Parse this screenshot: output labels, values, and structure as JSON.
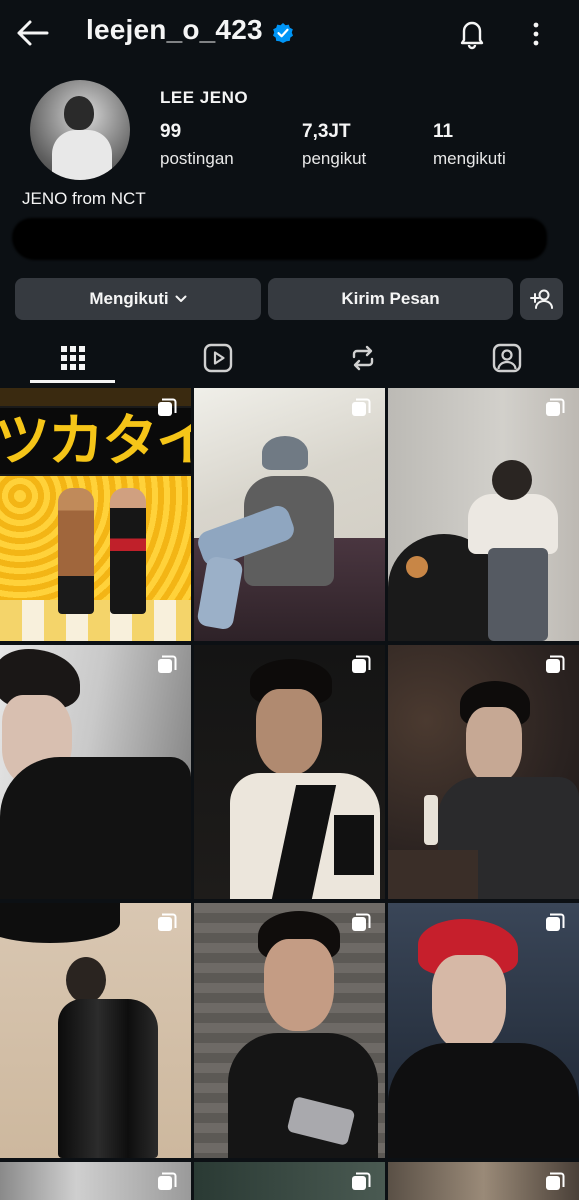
{
  "header": {
    "username": "leejen_o_423",
    "icons": [
      "back-arrow-icon",
      "verified-badge-icon",
      "bell-icon",
      "more-vertical-icon"
    ]
  },
  "profile": {
    "full_name": "LEE JENO",
    "bio": "JENO from NCT",
    "stats": [
      {
        "value": "99",
        "label": "postingan"
      },
      {
        "value": "7,3JT",
        "label": "pengikut"
      },
      {
        "value": "11",
        "label": "mengikuti"
      }
    ]
  },
  "actions": {
    "follow_label": "Mengikuti",
    "message_label": "Kirim Pesan"
  },
  "tabs": [
    {
      "name": "grid",
      "icon": "grid-icon",
      "active": true
    },
    {
      "name": "reels",
      "icon": "reels-icon",
      "active": false
    },
    {
      "name": "reposts",
      "icon": "repost-icon",
      "active": false
    },
    {
      "name": "tagged",
      "icon": "tagged-icon",
      "active": false
    }
  ],
  "posts": [
    {
      "type": "carousel",
      "content": "poster-banner"
    },
    {
      "type": "carousel",
      "content": "photo"
    },
    {
      "type": "carousel",
      "content": "photo"
    },
    {
      "type": "carousel",
      "content": "photo"
    },
    {
      "type": "carousel",
      "content": "photo"
    },
    {
      "type": "carousel",
      "content": "photo"
    },
    {
      "type": "carousel",
      "content": "photo"
    },
    {
      "type": "carousel",
      "content": "photo"
    },
    {
      "type": "carousel",
      "content": "photo"
    },
    {
      "type": "carousel",
      "content": "photo"
    },
    {
      "type": "carousel",
      "content": "photo"
    },
    {
      "type": "carousel",
      "content": "photo"
    }
  ],
  "poster_text": "ツカタイ",
  "colors": {
    "background": "#0c1014",
    "button": "#363a40",
    "verified": "#0095f6",
    "text": "#f5f5f5"
  }
}
